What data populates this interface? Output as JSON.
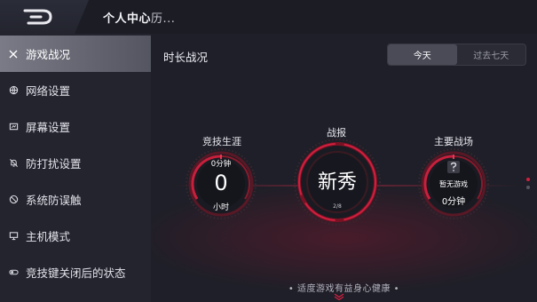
{
  "header": {
    "title": "个人中心",
    "title_tail": "历..."
  },
  "sidebar": {
    "items": [
      {
        "label": "游戏战况",
        "icon": "close-icon"
      },
      {
        "label": "网络设置",
        "icon": "globe-icon"
      },
      {
        "label": "屏幕设置",
        "icon": "screen-icon"
      },
      {
        "label": "防打扰设置",
        "icon": "bell-off-icon"
      },
      {
        "label": "系统防误触",
        "icon": "no-touch-icon"
      },
      {
        "label": "主机模式",
        "icon": "monitor-icon"
      },
      {
        "label": "竞技键关闭后的状态",
        "icon": "toggle-icon"
      }
    ]
  },
  "main": {
    "section_title": "时长战况",
    "tabs": [
      {
        "label": "今天",
        "active": true
      },
      {
        "label": "过去七天",
        "active": false
      }
    ],
    "dials": {
      "left": {
        "title": "竞技生涯",
        "top_text": "0分钟",
        "value": "0",
        "unit": "小时"
      },
      "center": {
        "title": "战报",
        "value": "新秀",
        "sub": "2/8"
      },
      "right": {
        "title": "主要战场",
        "empty_text": "暂无游戏",
        "value": "0分钟"
      }
    },
    "footer_hint": "• 适度游戏有益身心健康 •"
  },
  "colors": {
    "accent": "#d0203f",
    "accent_dark": "#7a1224",
    "background": "#1e1f28",
    "sidebar": "#23242e"
  }
}
